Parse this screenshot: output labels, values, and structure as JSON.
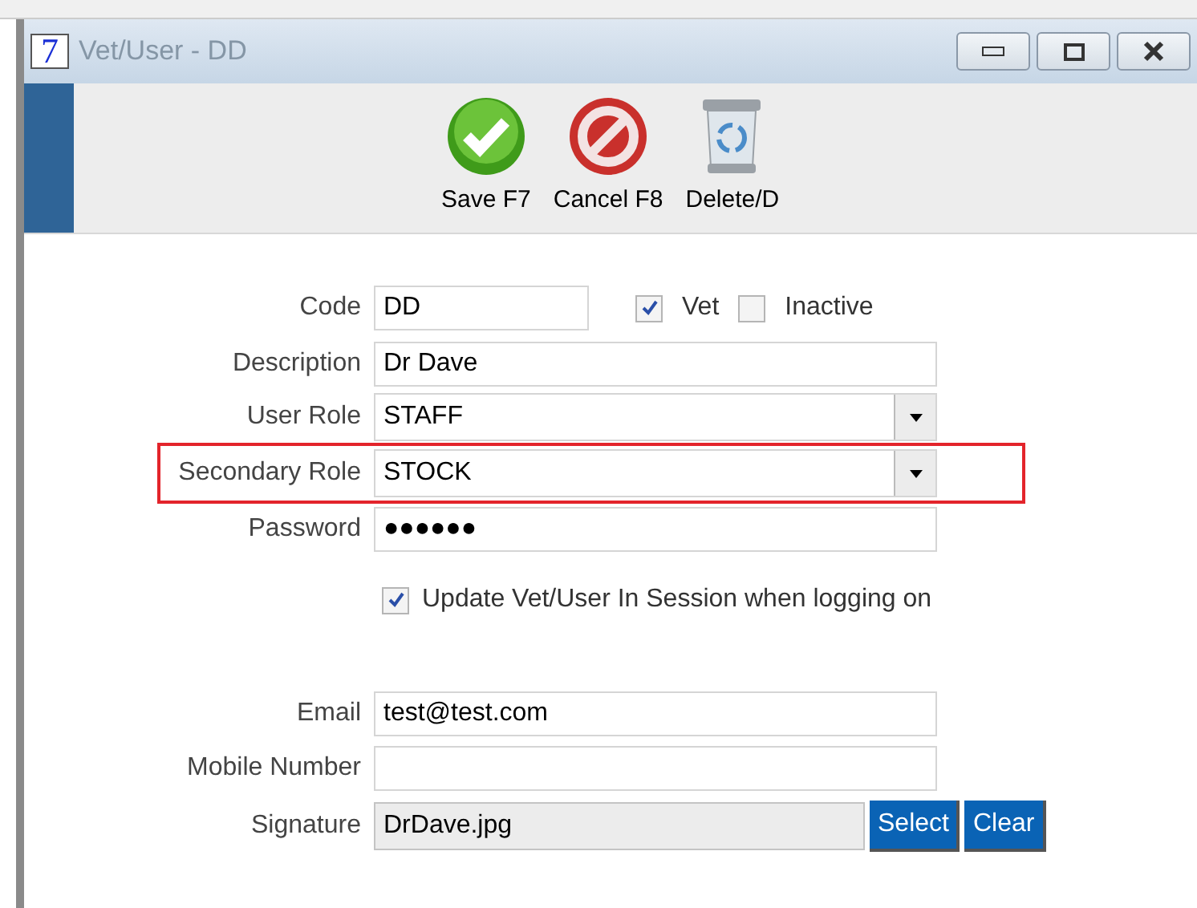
{
  "window": {
    "icon": "7",
    "title": "Vet/User - DD"
  },
  "toolbar": [
    {
      "kind": "save",
      "label": "Save F7"
    },
    {
      "kind": "cancel",
      "label": "Cancel F8"
    },
    {
      "kind": "delete",
      "label": "Delete/D"
    }
  ],
  "form": {
    "code": {
      "label": "Code",
      "value": "DD"
    },
    "checks": [
      {
        "label": "Vet",
        "checked": true
      },
      {
        "label": "Inactive",
        "checked": false
      }
    ],
    "fields": [
      {
        "kind": "text",
        "label": "Description",
        "value": "Dr Dave",
        "highlighted": false
      },
      {
        "kind": "dropdown",
        "label": "User Role",
        "value": "STAFF",
        "highlighted": false
      },
      {
        "kind": "dropdown",
        "label": "Secondary Role",
        "value": "STOCK",
        "highlighted": true
      },
      {
        "kind": "text",
        "label": "Password",
        "value": "●●●●●●",
        "highlighted": false
      }
    ],
    "session_check": {
      "label": "Update Vet/User In Session when logging on",
      "checked": true
    },
    "contact": [
      {
        "label": "Email",
        "value": "test@test.com"
      },
      {
        "label": "Mobile Number"
      }
    ],
    "signature": {
      "label": "Signature",
      "value": "DrDave.jpg",
      "buttons": [
        "Select",
        "Clear"
      ]
    }
  }
}
